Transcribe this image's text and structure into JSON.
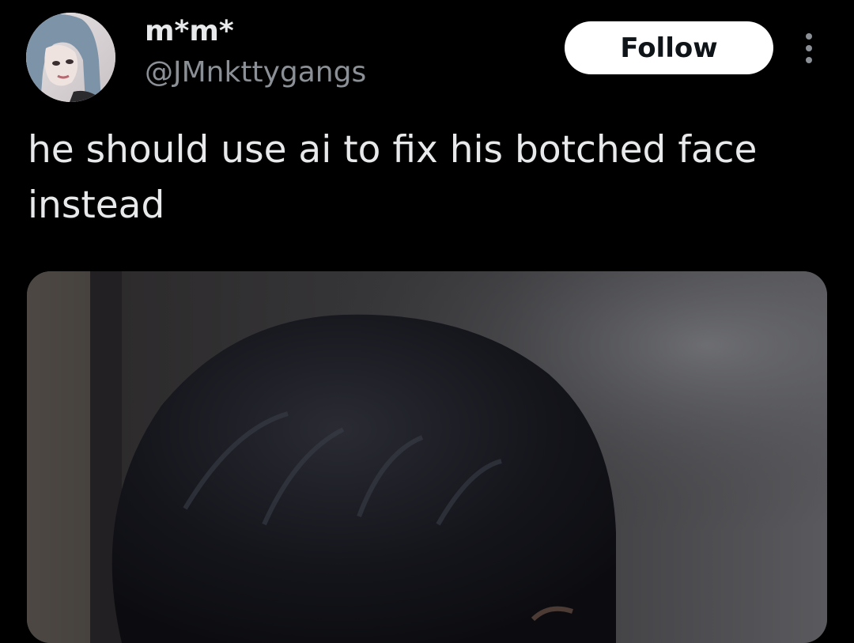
{
  "tweet": {
    "author": {
      "display_name": "m*m*",
      "handle": "@JMnkttygangs",
      "avatar_icon": "profile-avatar"
    },
    "follow_label": "Follow",
    "more_icon": "more-options-icon",
    "text": "he should use ai to fix his botched face instead",
    "media_icon": "attached-photo"
  },
  "colors": {
    "background": "#000000",
    "primary_text": "#e7e9ea",
    "secondary_text": "#8b9096",
    "follow_bg": "#ffffff",
    "follow_text": "#0f1419"
  }
}
